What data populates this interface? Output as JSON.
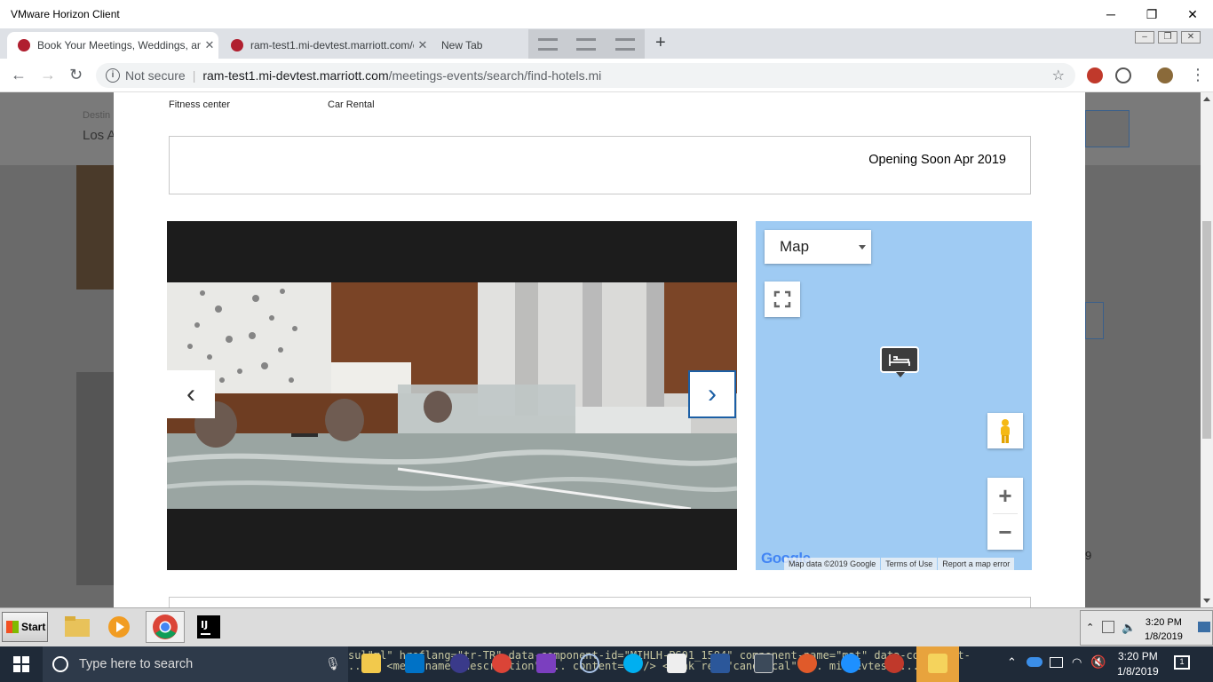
{
  "window": {
    "title": "VMware Horizon Client"
  },
  "tabs": [
    {
      "label": "Book Your Meetings, Weddings, and",
      "active": true
    },
    {
      "label": "ram-test1.mi-devtest.marriott.com/c",
      "active": false
    },
    {
      "label": "New Tab",
      "active": false
    }
  ],
  "omnibox": {
    "security": "Not secure",
    "host": "ram-test1.mi-devtest.marriott.com",
    "path": "/meetings-events/search/find-hotels.mi"
  },
  "background": {
    "destination_label": "Destin",
    "destination_value": "Los A",
    "side_number": "9"
  },
  "modal": {
    "amenities": [
      "Fitness center",
      "Car Rental"
    ],
    "opening_text": "Opening Soon Apr 2019",
    "carousel": {
      "prev_symbol": "‹",
      "next_symbol": "›"
    },
    "map": {
      "type_selected": "Map",
      "logo": "Google",
      "attribution": [
        "Map data ©2019 Google",
        "Terms of Use",
        "Report a map error"
      ]
    }
  },
  "vm_taskbar": {
    "start_label": "Start",
    "clock_time": "3:20 PM",
    "clock_date": "1/8/2019"
  },
  "win_taskbar": {
    "search_placeholder": "Type here to search",
    "code_line1": "sul\"ml\" hreflang=\"tr-TR\" data-component-id=\"MIHLH-PS01_1584\" component-name=\"mat\" data-component-endpoint=\"/aries-",
    "code_line2": ".. .. <meta name=\"description\" ... content=\"\" /> <link rel=\"canonical\" ... mi-devtest ... ",
    "clock_time": "3:20 PM",
    "clock_date": "1/8/2019",
    "notification_count": "1"
  },
  "colors": {
    "map_water": "#9fcbf3",
    "brand_red": "#b01f2f",
    "carousel_arrow": "#1c5fa5"
  }
}
